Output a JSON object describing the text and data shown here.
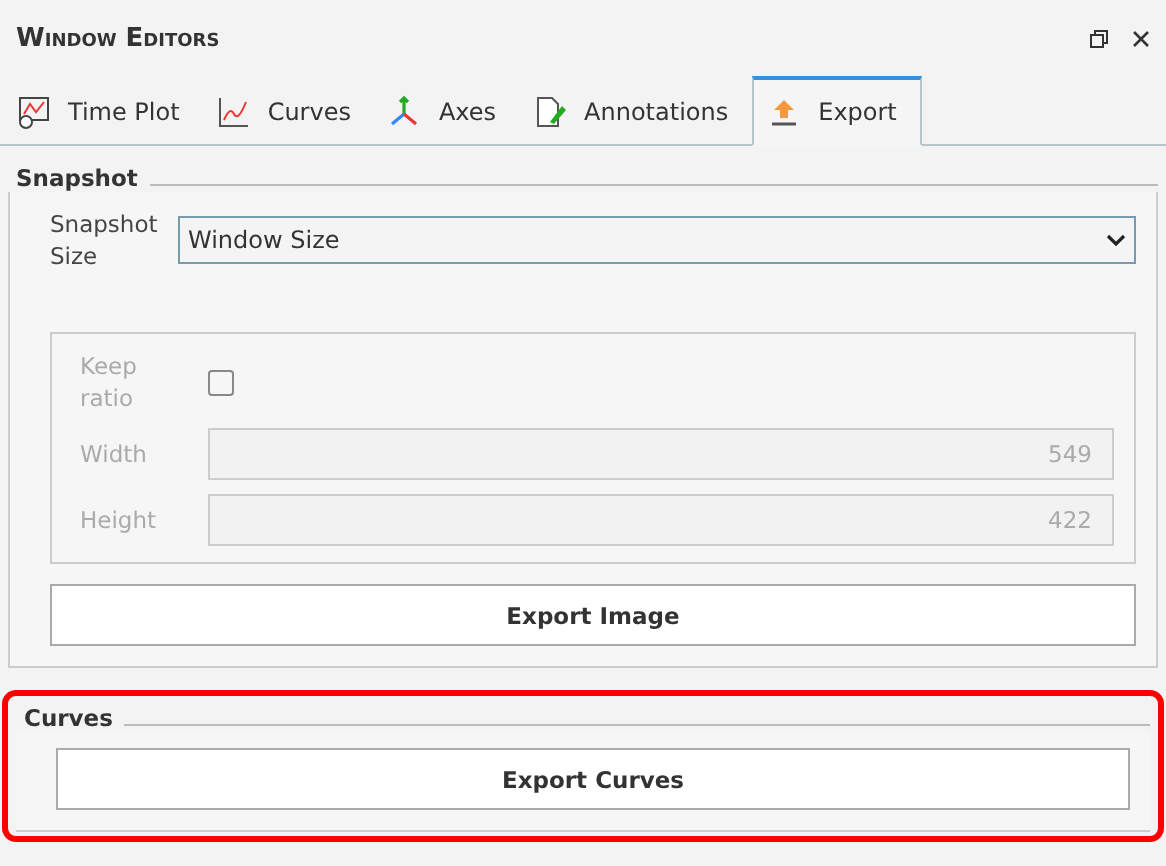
{
  "window": {
    "title": "Window Editors"
  },
  "tabs": [
    {
      "label": "Time Plot",
      "selected": false
    },
    {
      "label": "Curves",
      "selected": false
    },
    {
      "label": "Axes",
      "selected": false
    },
    {
      "label": "Annotations",
      "selected": false
    },
    {
      "label": "Export",
      "selected": true
    }
  ],
  "snapshot": {
    "title": "Snapshot",
    "size_label": "Snapshot Size",
    "size_value": "Window Size",
    "custom": {
      "disabled": true,
      "keep_ratio": {
        "label": "Keep ratio",
        "checked": false
      },
      "fields": [
        {
          "label": "Width",
          "value": "549"
        },
        {
          "label": "Height",
          "value": "422"
        }
      ]
    },
    "button": "Export Image"
  },
  "curves": {
    "title": "Curves",
    "highlighted": true,
    "button": "Export Curves"
  }
}
